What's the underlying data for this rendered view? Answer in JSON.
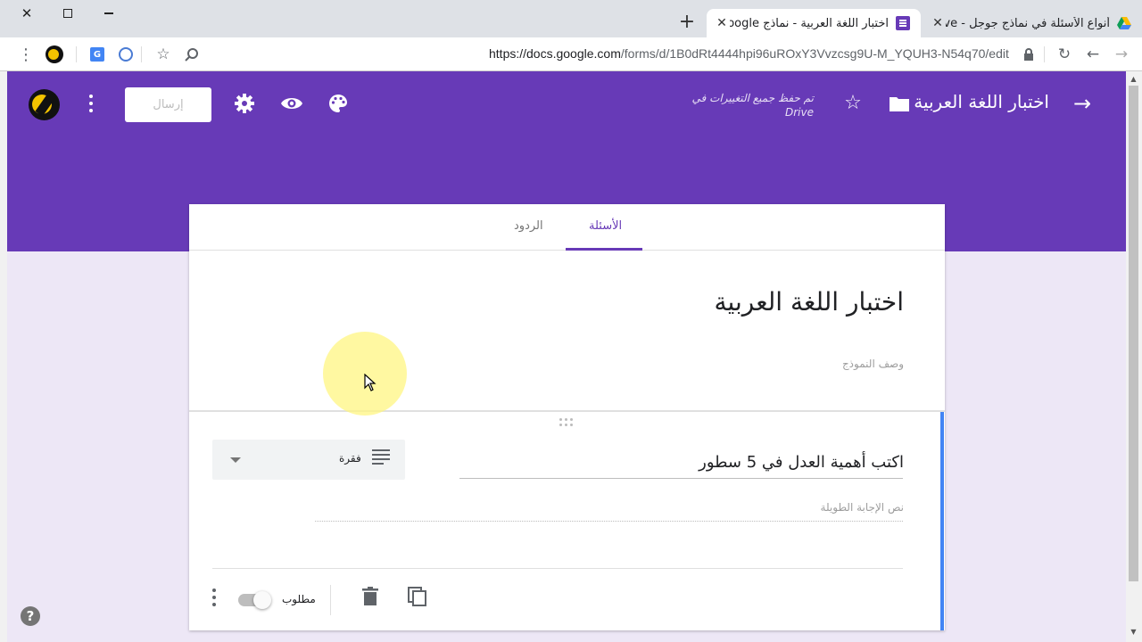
{
  "browser": {
    "active_tab_title": "اختبار اللغة العربية - نماذج Google",
    "inactive_tab_title": "أنواع الأسئلة في نماذج جوجل - Drive",
    "url_host": "https://docs.google.com",
    "url_path": "/forms/d/1B0dRt4444hpi96uROxY3Vvzcsg9U-M_YQUH3-N54q70/edit",
    "icons": [
      "close-icon",
      "maximize-icon",
      "minimize-icon",
      "new-tab-icon",
      "lock-icon",
      "reload-icon",
      "back-icon",
      "forward-icon",
      "bookmark-star-icon",
      "zoom-icon",
      "menu-dots-icon"
    ]
  },
  "header": {
    "form_title": "اختبار اللغة العربية",
    "saved_status": "تم حفظ جميع التغييرات في Drive",
    "send_label": "إرسال",
    "accent_color": "#673ab7"
  },
  "tabs": {
    "questions": "الأسئلة",
    "responses": "الردود"
  },
  "form": {
    "title": "اختبار اللغة العربية",
    "description_placeholder": "وصف النموذج"
  },
  "question": {
    "title": "اكتب أهمية العدل في 5 سطور",
    "type": "فقرة",
    "answer_placeholder": "نص الإجابة الطويلة",
    "required_label": "مطلوب",
    "required": false
  },
  "help": {
    "label": "?"
  }
}
